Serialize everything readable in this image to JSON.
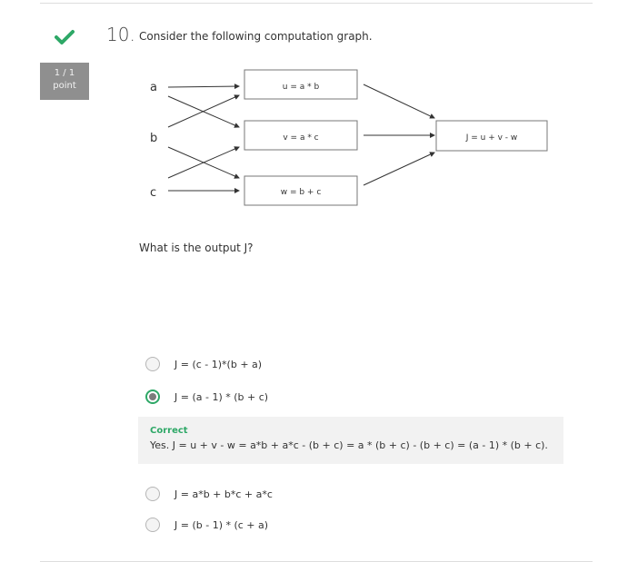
{
  "question": {
    "number": "10.",
    "prompt": "Consider the following computation graph.",
    "sub_prompt": "What is the output J?"
  },
  "score": {
    "value": "1 / 1",
    "unit": "point"
  },
  "colors": {
    "correct": "#2ea867",
    "score_bg": "#8f8f8f"
  },
  "graph": {
    "inputs": [
      "a",
      "b",
      "c"
    ],
    "nodes": [
      "u = a * b",
      "v = a * c",
      "w = b + c"
    ],
    "output": "J = u + v - w"
  },
  "options": [
    {
      "label": "J = (c - 1)*(b + a)",
      "selected": false
    },
    {
      "label": "J = (a - 1) * (b + c)",
      "selected": true
    },
    {
      "label": "J = a*b + b*c + a*c",
      "selected": false
    },
    {
      "label": "J = (b - 1) * (c + a)",
      "selected": false
    }
  ],
  "feedback": {
    "title": "Correct",
    "text": "Yes. J = u + v - w = a*b + a*c - (b + c) = a * (b + c) - (b + c) = (a - 1) * (b + c)."
  }
}
